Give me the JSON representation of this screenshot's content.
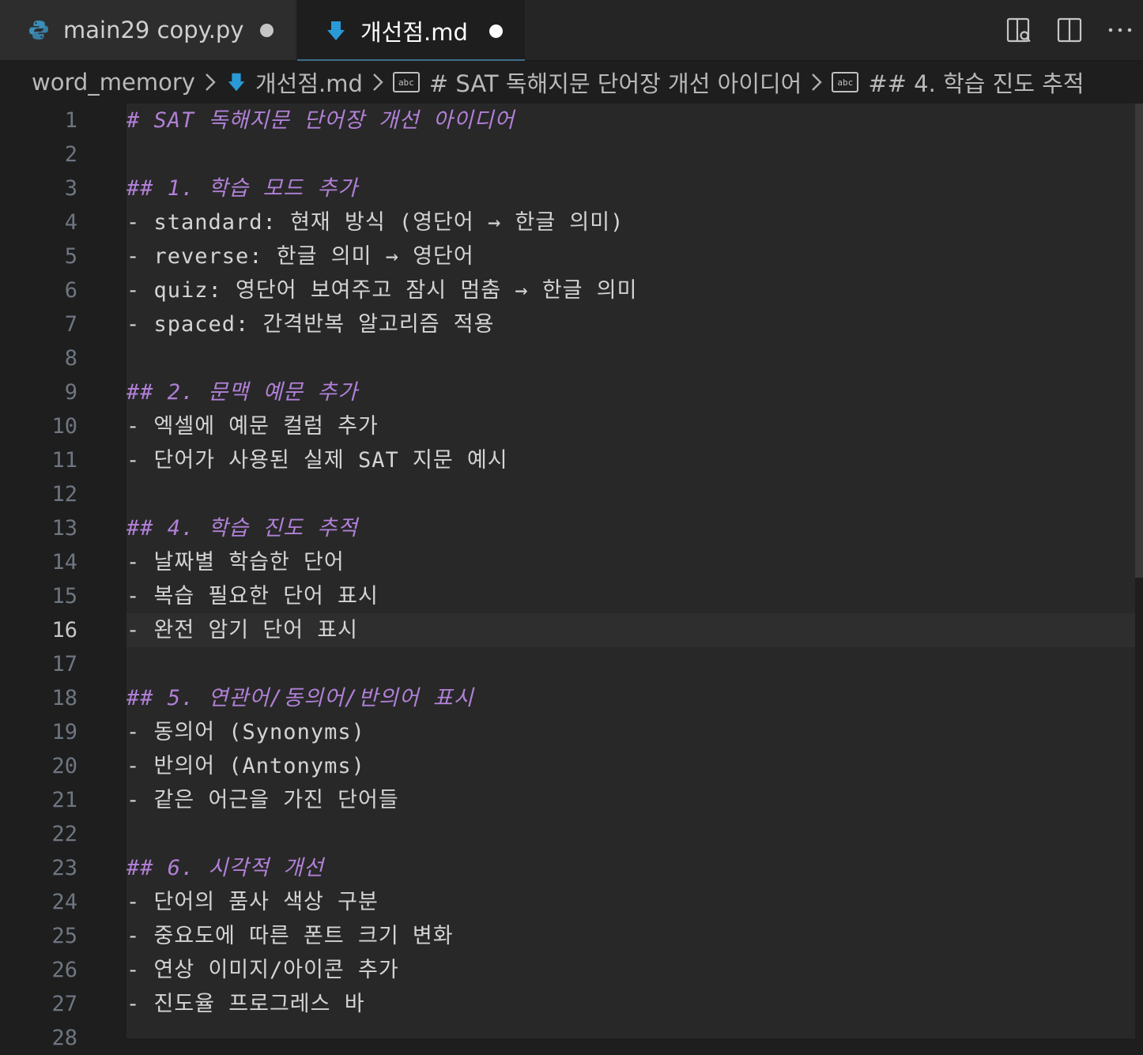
{
  "tabs": [
    {
      "label": "main29 copy.py",
      "icon": "python-icon",
      "modified": true,
      "active": false
    },
    {
      "label": "개선점.md",
      "icon": "markdown-arrow-icon",
      "modified": true,
      "active": true
    }
  ],
  "actions": [
    "open-preview-icon",
    "split-editor-icon",
    "more-actions-icon"
  ],
  "breadcrumb": {
    "folder": "word_memory",
    "file": "개선점.md",
    "symbol1": "# SAT 독해지문 단어장 개선 아이디어",
    "symbol2": "## 4. 학습 진도 추적"
  },
  "editor": {
    "active_line": 16,
    "lines": [
      {
        "n": "1",
        "text": "# SAT 독해지문 단어장 개선 아이디어",
        "kind": "heading"
      },
      {
        "n": "2",
        "text": "",
        "kind": "text"
      },
      {
        "n": "3",
        "text": "## 1. 학습 모드 추가",
        "kind": "heading"
      },
      {
        "n": "4",
        "text": "- standard: 현재 방식 (영단어 → 한글 의미)",
        "kind": "text"
      },
      {
        "n": "5",
        "text": "- reverse: 한글 의미 → 영단어",
        "kind": "text"
      },
      {
        "n": "6",
        "text": "- quiz: 영단어 보여주고 잠시 멈춤 → 한글 의미",
        "kind": "text"
      },
      {
        "n": "7",
        "text": "- spaced: 간격반복 알고리즘 적용",
        "kind": "text"
      },
      {
        "n": "8",
        "text": "",
        "kind": "text"
      },
      {
        "n": "9",
        "text": "## 2. 문맥 예문 추가",
        "kind": "heading"
      },
      {
        "n": "10",
        "text": "- 엑셀에 예문 컬럼 추가",
        "kind": "text"
      },
      {
        "n": "11",
        "text": "- 단어가 사용된 실제 SAT 지문 예시",
        "kind": "text"
      },
      {
        "n": "12",
        "text": "",
        "kind": "text"
      },
      {
        "n": "13",
        "text": "## 4. 학습 진도 추적",
        "kind": "heading"
      },
      {
        "n": "14",
        "text": "- 날짜별 학습한 단어",
        "kind": "text"
      },
      {
        "n": "15",
        "text": "- 복습 필요한 단어 표시",
        "kind": "text"
      },
      {
        "n": "16",
        "text": "- 완전 암기 단어 표시",
        "kind": "text"
      },
      {
        "n": "17",
        "text": "",
        "kind": "text"
      },
      {
        "n": "18",
        "text": "## 5. 연관어/동의어/반의어 표시",
        "kind": "heading"
      },
      {
        "n": "19",
        "text": "- 동의어 (Synonyms)",
        "kind": "text"
      },
      {
        "n": "20",
        "text": "- 반의어 (Antonyms)",
        "kind": "text"
      },
      {
        "n": "21",
        "text": "- 같은 어근을 가진 단어들",
        "kind": "text"
      },
      {
        "n": "22",
        "text": "",
        "kind": "text"
      },
      {
        "n": "23",
        "text": "## 6. 시각적 개선",
        "kind": "heading"
      },
      {
        "n": "24",
        "text": "- 단어의 품사 색상 구분",
        "kind": "text"
      },
      {
        "n": "25",
        "text": "- 중요도에 따른 폰트 크기 변화",
        "kind": "text"
      },
      {
        "n": "26",
        "text": "- 연상 이미지/아이콘 추가",
        "kind": "text"
      },
      {
        "n": "27",
        "text": "- 진도율 프로그레스 바",
        "kind": "text"
      },
      {
        "n": "28",
        "text": "",
        "kind": "text"
      }
    ]
  },
  "colors": {
    "heading": "#b180d7",
    "text": "#d4d4d4",
    "line_number": "#6e7681",
    "active_line_number": "#c6c6c6",
    "python_icon": "#3b8eb8",
    "markdown_icon": "#2a9ad6"
  }
}
